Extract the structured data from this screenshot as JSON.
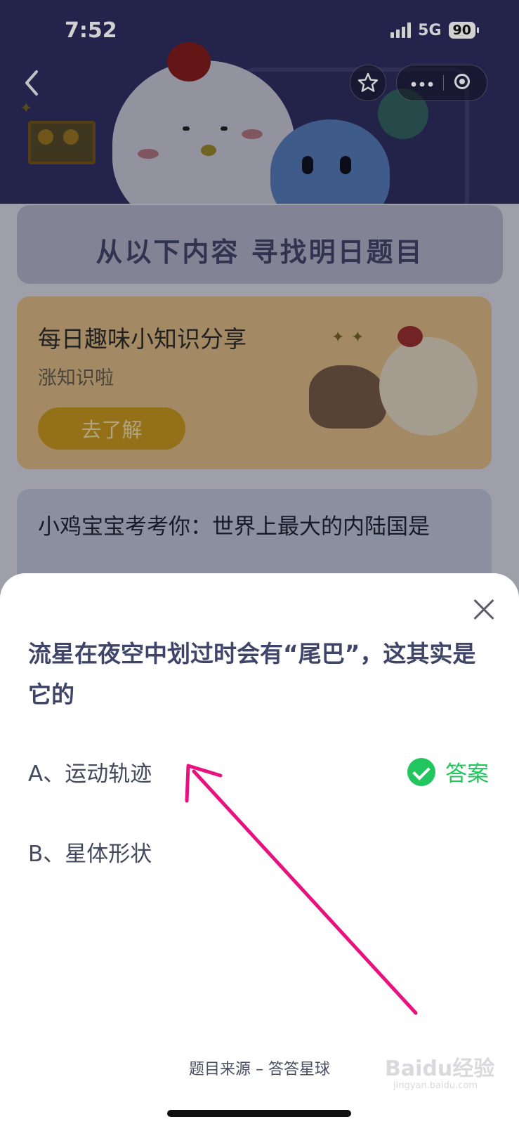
{
  "status_bar": {
    "time": "7:52",
    "network": "5G",
    "battery": "90"
  },
  "nav": {
    "back_icon": "chevron-left-icon",
    "favorite_icon": "star-icon",
    "more_icon": "more-dots-icon",
    "close_icon": "target-circle-icon"
  },
  "background_page": {
    "hero_title": "从以下内容 寻找明日题目",
    "trivia_card": {
      "title": "每日趣味小知识分享",
      "subtitle": "涨知识啦",
      "button": "去了解"
    },
    "quiz_card": {
      "question": "小鸡宝宝考考你：世界上最大的内陆国是"
    }
  },
  "sheet": {
    "question": "流星在夜空中划过时会有“尾巴”，这其实是它的",
    "options": [
      {
        "label": "A、运动轨迹"
      },
      {
        "label": "B、星体形状"
      }
    ],
    "answer_label": "答案",
    "source": "题目来源 – 答答星球"
  },
  "watermark": {
    "text": "Baidu经验",
    "sub": "jingyan.baidu.com"
  },
  "colors": {
    "accent_green": "#22c55e",
    "annotation_arrow": "#e8117f"
  }
}
